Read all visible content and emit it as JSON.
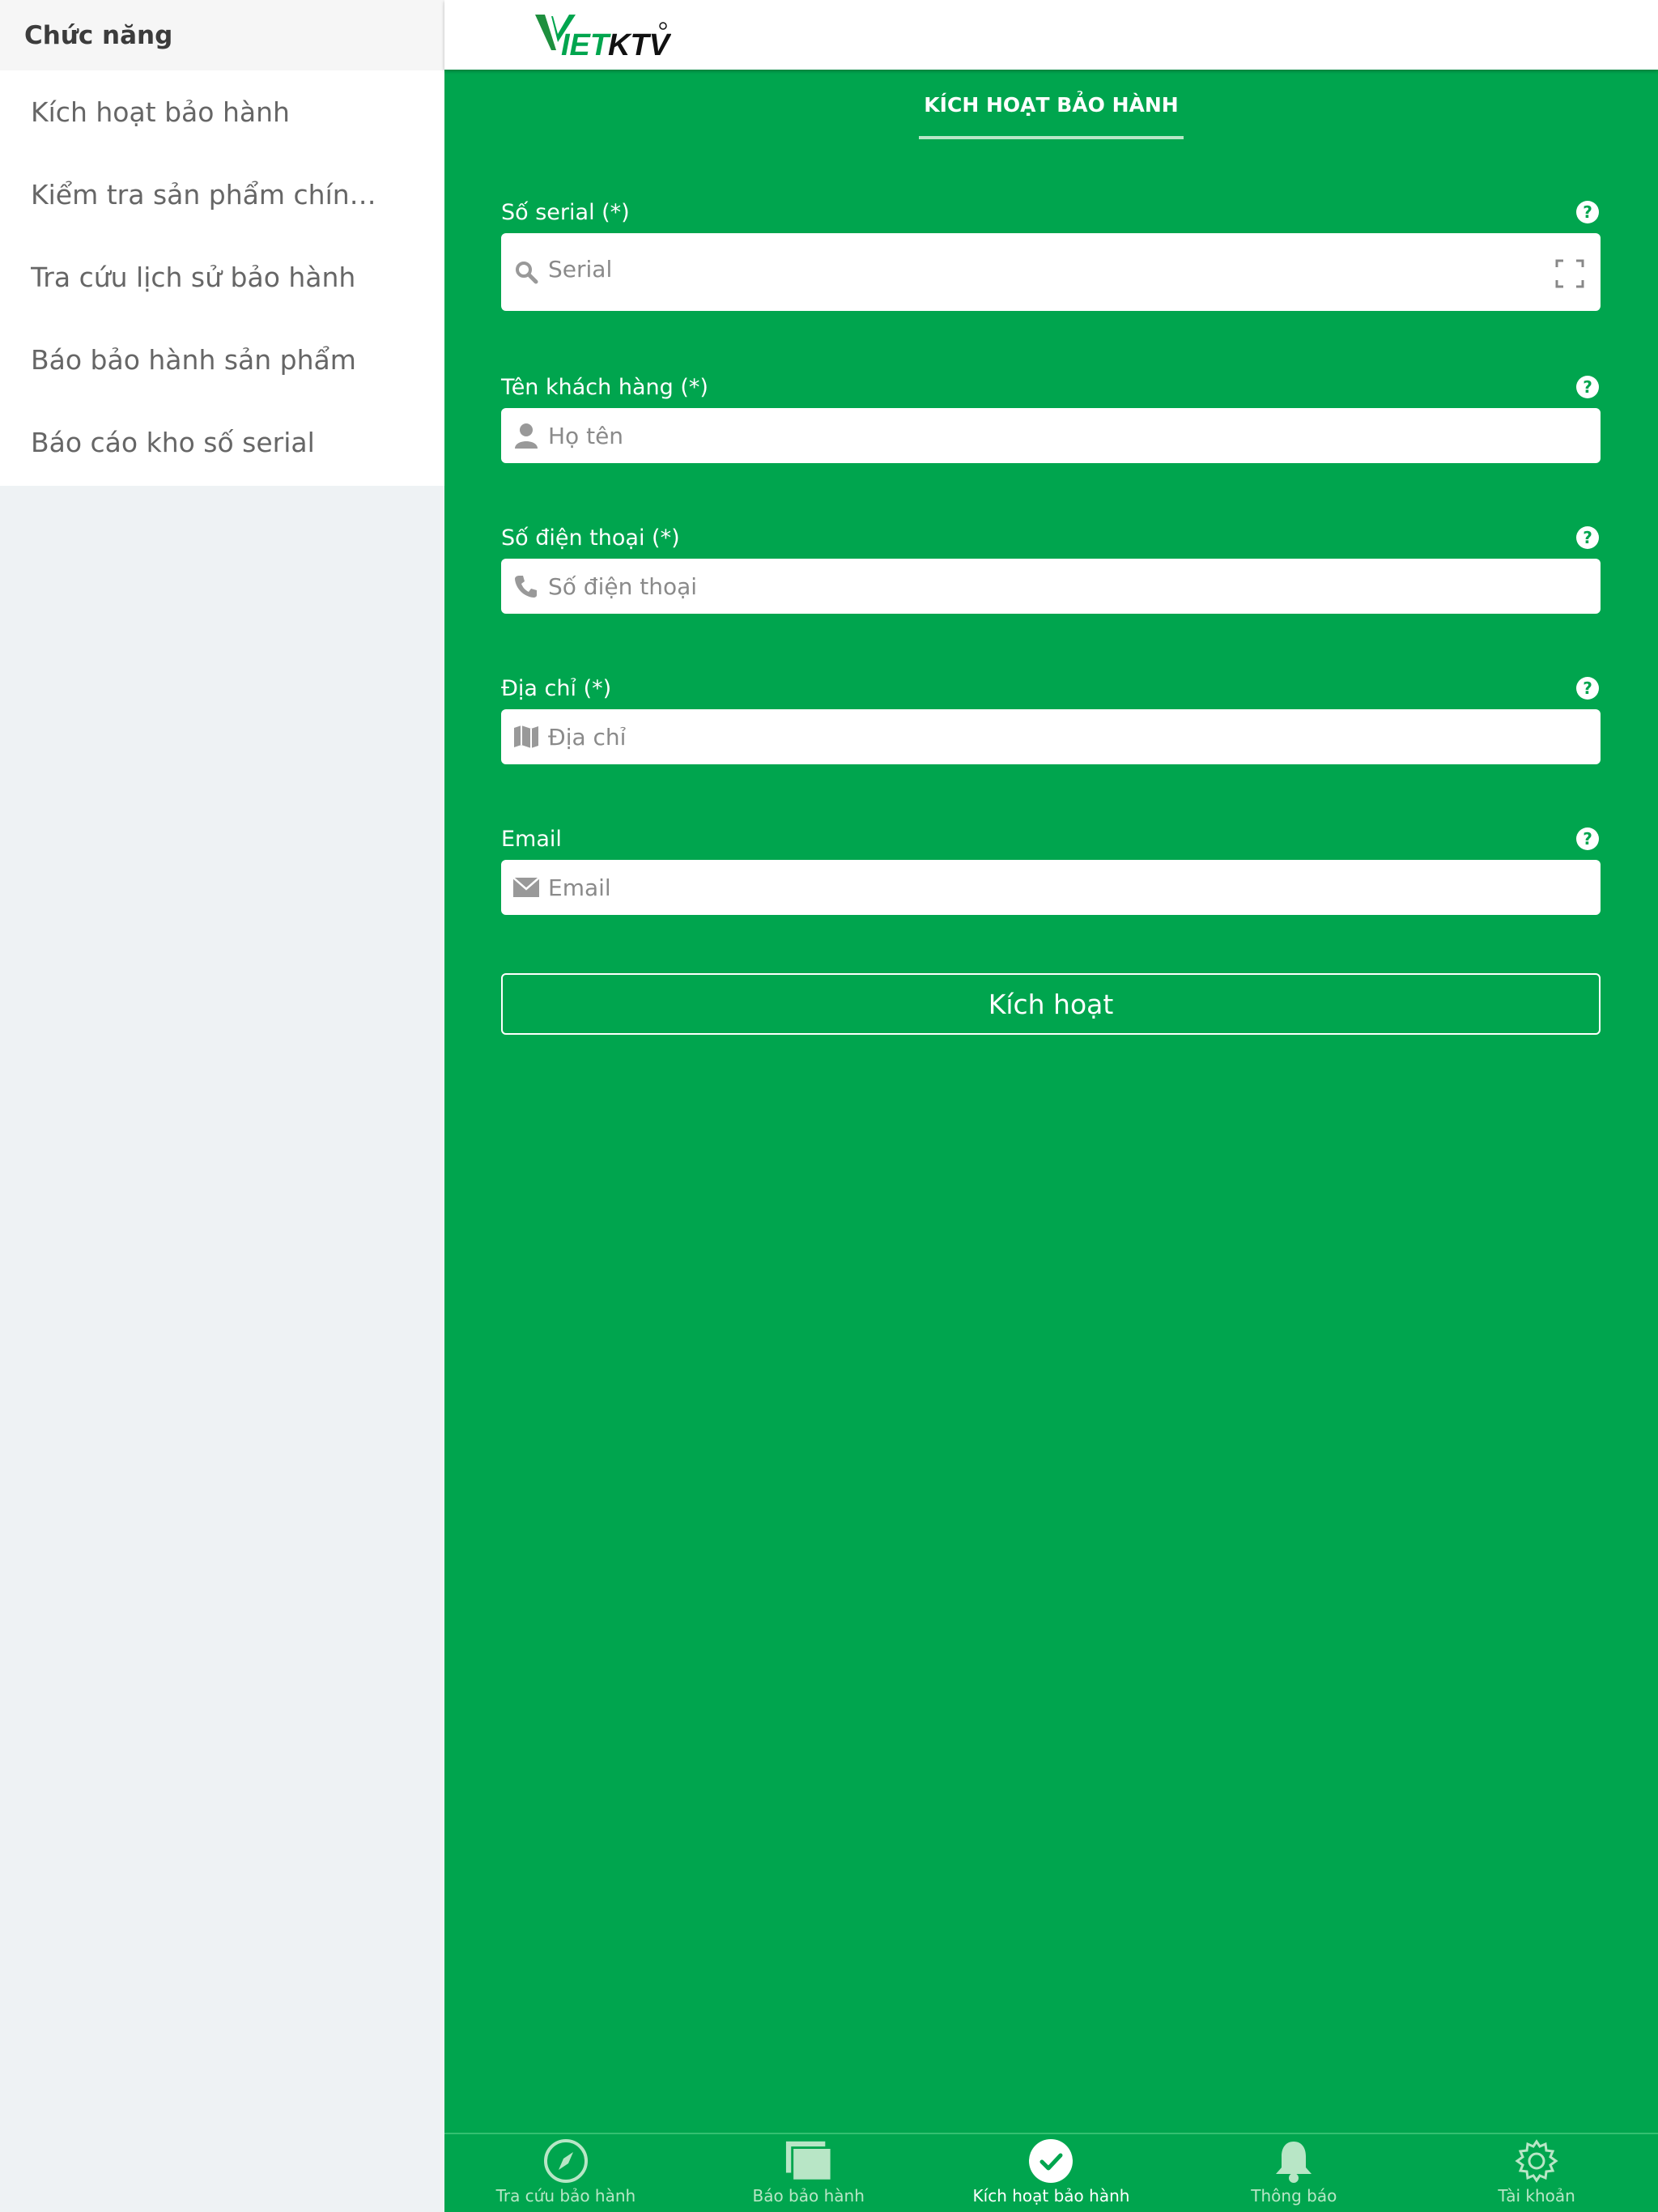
{
  "sidebar": {
    "title": "Chức năng",
    "items": [
      {
        "label": "Kích hoạt bảo hành"
      },
      {
        "label": "Kiểm tra sản phẩm chính hãng"
      },
      {
        "label": "Tra cứu lịch sử bảo hành"
      },
      {
        "label": "Báo bảo hành sản phẩm"
      },
      {
        "label": "Báo cáo kho số serial"
      }
    ]
  },
  "header": {
    "logo_text": "VIETKTV",
    "active_tab": "KÍCH HOẠT BẢO HÀNH"
  },
  "form": {
    "serial": {
      "label": "Số serial (*)",
      "placeholder": "Serial",
      "icon": "search-icon"
    },
    "name": {
      "label": "Tên khách hàng (*)",
      "placeholder": "Họ tên",
      "icon": "person-icon"
    },
    "phone": {
      "label": "Số điện thoại (*)",
      "placeholder": "Số điện thoại",
      "icon": "phone-icon"
    },
    "address": {
      "label": "Địa chỉ (*)",
      "placeholder": "Địa chỉ",
      "icon": "map-icon"
    },
    "email": {
      "label": "Email",
      "placeholder": "Email",
      "icon": "mail-icon"
    },
    "help_glyph": "?",
    "submit_label": "Kích hoạt"
  },
  "bottom_nav": {
    "items": [
      {
        "label": "Tra cứu bảo hành",
        "icon": "compass-icon"
      },
      {
        "label": "Báo bảo hành",
        "icon": "cards-icon"
      },
      {
        "label": "Kích hoạt bảo hành",
        "icon": "check-circle-icon"
      },
      {
        "label": "Thông báo",
        "icon": "bell-icon"
      },
      {
        "label": "Tài khoản",
        "icon": "gear-icon"
      }
    ]
  },
  "colors": {
    "primary": "#00a54e",
    "accent_light": "#b8e6c6",
    "sidebar_bg": "#eef2f4"
  }
}
